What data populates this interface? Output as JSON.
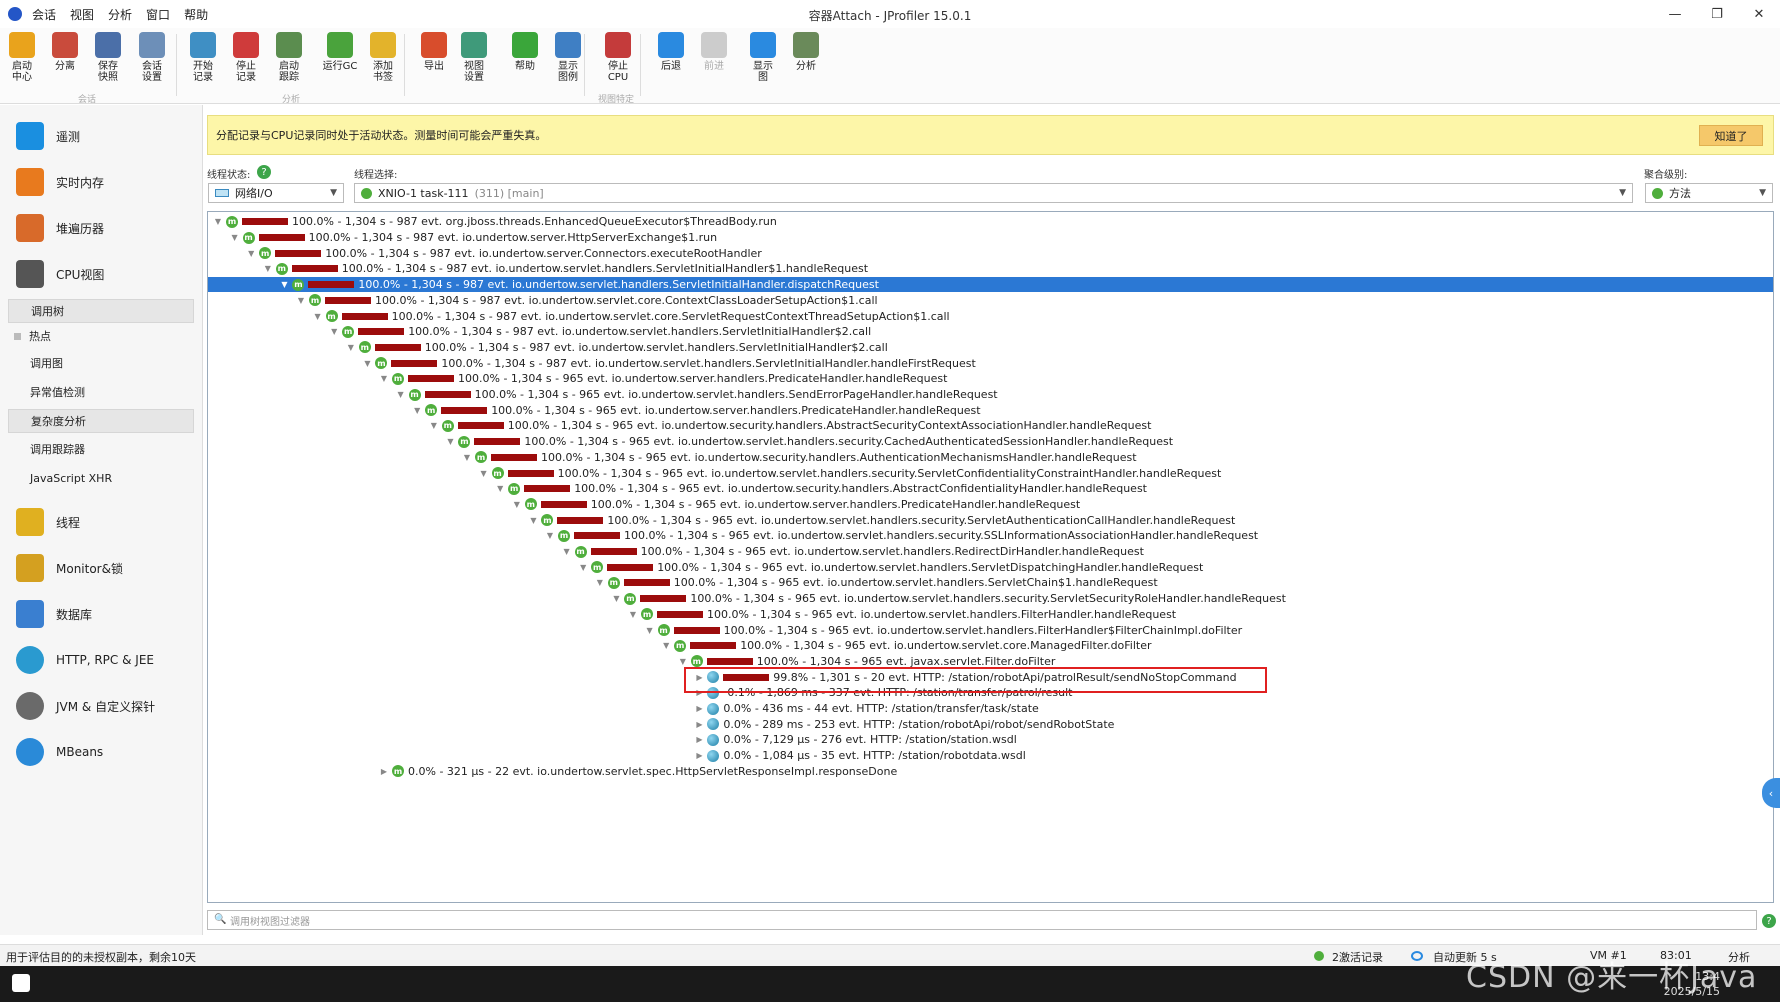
{
  "window": {
    "title": "容器Attach - JProfiler 15.0.1",
    "menu": [
      "会话",
      "视图",
      "分析",
      "窗口",
      "帮助"
    ],
    "controls": [
      "—",
      "❐",
      "✕"
    ]
  },
  "toolbar": {
    "buttons": [
      {
        "label": "启动\n中心",
        "color": "#e9a31c"
      },
      {
        "label": "分离",
        "color": "#c94b3c"
      },
      {
        "label": "保存\n快照",
        "color": "#4b6fa8"
      },
      {
        "label": "会话\n设置",
        "color": "#6d8fb8"
      },
      {
        "label": "开始\n记录",
        "color": "#3f8fc4"
      },
      {
        "label": "停止\n记录",
        "color": "#cf3b3b"
      },
      {
        "label": "启动\n跟踪",
        "color": "#5b8d4f"
      },
      {
        "label": "运行GC",
        "color": "#4aa33c"
      },
      {
        "label": "添加\n书签",
        "color": "#e3b32b"
      },
      {
        "label": "导出",
        "color": "#d84d2c"
      },
      {
        "label": "视图\n设置",
        "color": "#3f9a7a"
      },
      {
        "label": "帮助",
        "color": "#3aa63a"
      },
      {
        "label": "显示\n图例",
        "color": "#3f7fc4"
      },
      {
        "label": "停止\nCPU",
        "color": "#c43b3b"
      },
      {
        "label": "后退",
        "color": "#2a8ae0"
      },
      {
        "label": "前进",
        "color": "#cccccc"
      },
      {
        "label": "显示\n图",
        "color": "#2a8ae0"
      },
      {
        "label": "分析",
        "color": "#6a8a5a"
      }
    ],
    "groups": [
      "会话",
      "分析",
      "视图特定"
    ]
  },
  "sidebar": {
    "items": [
      {
        "label": "遥测",
        "color": "#1a8fe0"
      },
      {
        "label": "实时内存",
        "color": "#e87a1e"
      },
      {
        "label": "堆遍历器",
        "color": "#d86a2a"
      },
      {
        "label": "CPU视图",
        "color": "#555555"
      },
      {
        "label": "线程",
        "color": "#e0b020"
      },
      {
        "label": "Monitor&锁",
        "color": "#d4a020"
      },
      {
        "label": "数据库",
        "color": "#3a7fd0"
      },
      {
        "label": "HTTP, RPC & JEE",
        "color": "#2a9ad0"
      },
      {
        "label": "JVM & 自定义探针",
        "color": "#6a6a6a"
      },
      {
        "label": "MBeans",
        "color": "#2a8ad8"
      }
    ],
    "cpu_sub": {
      "call_tree": "调用树",
      "hotspots_group": "热点",
      "call_graph": "调用图",
      "outlier": "异常值检测",
      "complexity": "复杂度分析",
      "call_tracer": "调用跟踪器",
      "js_xhr": "JavaScript XHR"
    }
  },
  "banner": {
    "text": "分配记录与CPU记录同时处于活动状态。测量时间可能会严重失真。",
    "button": "知道了"
  },
  "filters": {
    "thread_state_label": "线程状态:",
    "thread_state_value": "网络I/O",
    "thread_select_label": "线程选择:",
    "thread_select_value": "XNIO-1 task-111",
    "thread_select_suffix": "(311) [main]",
    "aggregation_label": "聚合级别:",
    "aggregation_value": "方法"
  },
  "tree": {
    "rows": [
      {
        "d": 0,
        "t": "▼",
        "i": "m",
        "b": 1.0,
        "text": "100.0% - 1,304 s - 987 evt. org.jboss.threads.EnhancedQueueExecutor$ThreadBody.run"
      },
      {
        "d": 1,
        "t": "▼",
        "i": "m",
        "b": 1.0,
        "text": "100.0% - 1,304 s - 987 evt. io.undertow.server.HttpServerExchange$1.run"
      },
      {
        "d": 2,
        "t": "▼",
        "i": "m",
        "b": 1.0,
        "text": "100.0% - 1,304 s - 987 evt. io.undertow.server.Connectors.executeRootHandler"
      },
      {
        "d": 3,
        "t": "▼",
        "i": "m",
        "b": 1.0,
        "text": "100.0% - 1,304 s - 987 evt. io.undertow.servlet.handlers.ServletInitialHandler$1.handleRequest"
      },
      {
        "d": 4,
        "t": "▼",
        "i": "m",
        "b": 1.0,
        "sel": true,
        "text": "100.0% - 1,304 s - 987 evt. io.undertow.servlet.handlers.ServletInitialHandler.dispatchRequest"
      },
      {
        "d": 5,
        "t": "▼",
        "i": "m",
        "b": 1.0,
        "text": "100.0% - 1,304 s - 987 evt. io.undertow.servlet.core.ContextClassLoaderSetupAction$1.call"
      },
      {
        "d": 6,
        "t": "▼",
        "i": "m",
        "b": 1.0,
        "text": "100.0% - 1,304 s - 987 evt. io.undertow.servlet.core.ServletRequestContextThreadSetupAction$1.call"
      },
      {
        "d": 7,
        "t": "▼",
        "i": "m",
        "b": 1.0,
        "text": "100.0% - 1,304 s - 987 evt. io.undertow.servlet.handlers.ServletInitialHandler$2.call"
      },
      {
        "d": 8,
        "t": "▼",
        "i": "m",
        "b": 1.0,
        "text": "100.0% - 1,304 s - 987 evt. io.undertow.servlet.handlers.ServletInitialHandler$2.call"
      },
      {
        "d": 9,
        "t": "▼",
        "i": "m",
        "b": 1.0,
        "text": "100.0% - 1,304 s - 987 evt. io.undertow.servlet.handlers.ServletInitialHandler.handleFirstRequest"
      },
      {
        "d": 10,
        "t": "▼",
        "i": "m",
        "b": 1.0,
        "text": "100.0% - 1,304 s - 965 evt. io.undertow.server.handlers.PredicateHandler.handleRequest"
      },
      {
        "d": 11,
        "t": "▼",
        "i": "m",
        "b": 1.0,
        "text": "100.0% - 1,304 s - 965 evt. io.undertow.servlet.handlers.SendErrorPageHandler.handleRequest"
      },
      {
        "d": 12,
        "t": "▼",
        "i": "m",
        "b": 1.0,
        "text": "100.0% - 1,304 s - 965 evt. io.undertow.server.handlers.PredicateHandler.handleRequest"
      },
      {
        "d": 13,
        "t": "▼",
        "i": "m",
        "b": 1.0,
        "text": "100.0% - 1,304 s - 965 evt. io.undertow.security.handlers.AbstractSecurityContextAssociationHandler.handleRequest"
      },
      {
        "d": 14,
        "t": "▼",
        "i": "m",
        "b": 1.0,
        "text": "100.0% - 1,304 s - 965 evt. io.undertow.servlet.handlers.security.CachedAuthenticatedSessionHandler.handleRequest"
      },
      {
        "d": 15,
        "t": "▼",
        "i": "m",
        "b": 1.0,
        "text": "100.0% - 1,304 s - 965 evt. io.undertow.security.handlers.AuthenticationMechanismsHandler.handleRequest"
      },
      {
        "d": 16,
        "t": "▼",
        "i": "m",
        "b": 1.0,
        "text": "100.0% - 1,304 s - 965 evt. io.undertow.servlet.handlers.security.ServletConfidentialityConstraintHandler.handleRequest"
      },
      {
        "d": 17,
        "t": "▼",
        "i": "m",
        "b": 1.0,
        "text": "100.0% - 1,304 s - 965 evt. io.undertow.security.handlers.AbstractConfidentialityHandler.handleRequest"
      },
      {
        "d": 18,
        "t": "▼",
        "i": "m",
        "b": 1.0,
        "text": "100.0% - 1,304 s - 965 evt. io.undertow.server.handlers.PredicateHandler.handleRequest"
      },
      {
        "d": 19,
        "t": "▼",
        "i": "m",
        "b": 1.0,
        "text": "100.0% - 1,304 s - 965 evt. io.undertow.servlet.handlers.security.ServletAuthenticationCallHandler.handleRequest"
      },
      {
        "d": 20,
        "t": "▼",
        "i": "m",
        "b": 1.0,
        "text": "100.0% - 1,304 s - 965 evt. io.undertow.servlet.handlers.security.SSLInformationAssociationHandler.handleRequest"
      },
      {
        "d": 21,
        "t": "▼",
        "i": "m",
        "b": 1.0,
        "text": "100.0% - 1,304 s - 965 evt. io.undertow.servlet.handlers.RedirectDirHandler.handleRequest"
      },
      {
        "d": 22,
        "t": "▼",
        "i": "m",
        "b": 1.0,
        "text": "100.0% - 1,304 s - 965 evt. io.undertow.servlet.handlers.ServletDispatchingHandler.handleRequest"
      },
      {
        "d": 23,
        "t": "▼",
        "i": "m",
        "b": 1.0,
        "text": "100.0% - 1,304 s - 965 evt. io.undertow.servlet.handlers.ServletChain$1.handleRequest"
      },
      {
        "d": 24,
        "t": "▼",
        "i": "m",
        "b": 1.0,
        "text": "100.0% - 1,304 s - 965 evt. io.undertow.servlet.handlers.security.ServletSecurityRoleHandler.handleRequest"
      },
      {
        "d": 25,
        "t": "▼",
        "i": "m",
        "b": 1.0,
        "text": "100.0% - 1,304 s - 965 evt. io.undertow.servlet.handlers.FilterHandler.handleRequest"
      },
      {
        "d": 26,
        "t": "▼",
        "i": "m",
        "b": 1.0,
        "text": "100.0% - 1,304 s - 965 evt. io.undertow.servlet.handlers.FilterHandler$FilterChainImpl.doFilter"
      },
      {
        "d": 27,
        "t": "▼",
        "i": "m",
        "b": 1.0,
        "text": "100.0% - 1,304 s - 965 evt. io.undertow.servlet.core.ManagedFilter.doFilter"
      },
      {
        "d": 28,
        "t": "▼",
        "i": "m",
        "b": 1.0,
        "text": "100.0% - 1,304 s - 965 evt. javax.servlet.Filter.doFilter"
      },
      {
        "d": 29,
        "t": "▶",
        "i": "g",
        "b": 0.998,
        "text": "99.8% - 1,301 s - 20 evt. HTTP: /station/robotApi/patrolResult/sendNoStopCommand"
      },
      {
        "d": 29,
        "t": "▶",
        "i": "g",
        "b": 0.001,
        "text": "0.1% - 1,869 ms - 337 evt. HTTP: /station/transfer/patrol/result"
      },
      {
        "d": 29,
        "t": "▶",
        "i": "g",
        "b": 0,
        "text": "0.0% - 436 ms - 44 evt. HTTP: /station/transfer/task/state"
      },
      {
        "d": 29,
        "t": "▶",
        "i": "g",
        "b": 0,
        "text": "0.0% - 289 ms - 253 evt. HTTP: /station/robotApi/robot/sendRobotState"
      },
      {
        "d": 29,
        "t": "▶",
        "i": "g",
        "b": 0,
        "text": "0.0% - 7,129 µs - 276 evt. HTTP: /station/station.wsdl"
      },
      {
        "d": 29,
        "t": "▶",
        "i": "g",
        "b": 0,
        "text": "0.0% - 1,084 µs - 35 evt. HTTP: /station/robotdata.wsdl"
      },
      {
        "d": 10,
        "t": "▶",
        "i": "m",
        "b": 0,
        "text": "0.0% - 321 µs - 22 evt. io.undertow.servlet.spec.HttpServletResponseImpl.responseDone"
      }
    ]
  },
  "filter_input": {
    "placeholder": "调用树视图过滤器"
  },
  "status": {
    "left": "用于评估目的的未授权副本，剩余10天",
    "recordings": "2激活记录",
    "autoupdate": "自动更新 5 s",
    "vm": "VM #1",
    "time": "83:01",
    "analysis": "分析"
  },
  "taskbar": {
    "time": "13:4",
    "date": "2025/5/15",
    "watermark": "CSDN @来一杯Java"
  }
}
